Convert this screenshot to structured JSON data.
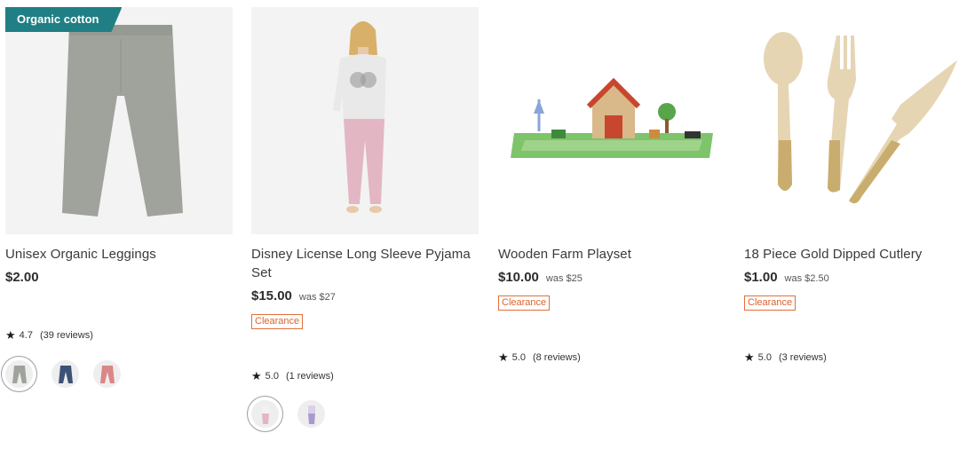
{
  "products": [
    {
      "badge": "Organic cotton",
      "title": "Unisex Organic Leggings",
      "price": "$2.00",
      "was": "",
      "clearance": "",
      "rating": "4.7",
      "reviews": "(39 reviews)",
      "swatches": [
        "grey",
        "navy",
        "pink"
      ],
      "colors": {
        "badge": "#1f7f84",
        "legging": "#9fa39c"
      }
    },
    {
      "badge": "",
      "title": "Disney License Long Sleeve Pyjama Set",
      "price": "$15.00",
      "was": "was $27",
      "clearance": "Clearance",
      "rating": "5.0",
      "reviews": "(1 reviews)",
      "swatches": [
        "pink",
        "lilac"
      ]
    },
    {
      "badge": "",
      "title": "Wooden Farm Playset",
      "price": "$10.00",
      "was": "was $25",
      "clearance": "Clearance",
      "rating": "5.0",
      "reviews": "(8 reviews)",
      "swatches": []
    },
    {
      "badge": "",
      "title": "18 Piece Gold Dipped Cutlery",
      "price": "$1.00",
      "was": "was $2.50",
      "clearance": "Clearance",
      "rating": "5.0",
      "reviews": "(3 reviews)",
      "swatches": []
    }
  ],
  "icons": {
    "rating": "star-icon"
  },
  "colors": {
    "clearance": "#d9632c",
    "accent": "#1f7f84"
  }
}
